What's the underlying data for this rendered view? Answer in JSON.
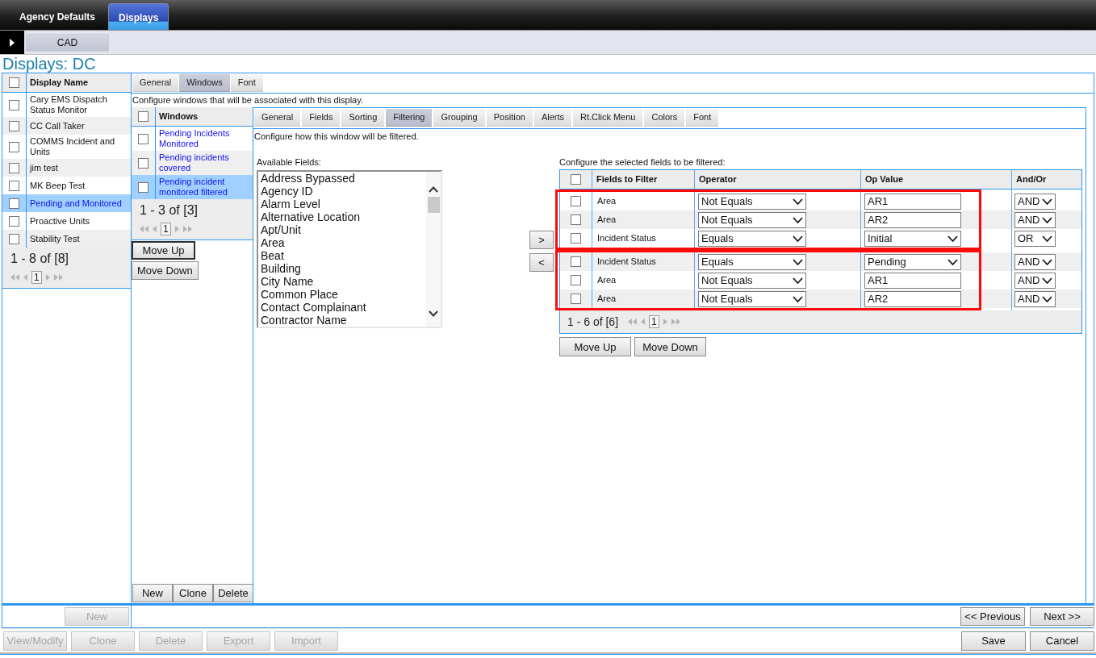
{
  "top_tabs": [
    {
      "label": "Agency Defaults",
      "selected": false
    },
    {
      "label": "Displays",
      "selected": true
    }
  ],
  "module_bar": {
    "module_button": "CAD"
  },
  "page_title": "Displays: DC",
  "displays_table": {
    "header": "Display Name",
    "header_checked": false,
    "rows": [
      {
        "name": "Cary EMS Dispatch Status Monitor",
        "checked": false,
        "selected": false
      },
      {
        "name": "CC Call Taker",
        "checked": false,
        "selected": false
      },
      {
        "name": "COMMS Incident and Units",
        "checked": false,
        "selected": false
      },
      {
        "name": "jim test",
        "checked": false,
        "selected": false
      },
      {
        "name": "MK Beep Test",
        "checked": false,
        "selected": false
      },
      {
        "name": "Pending and Monitored",
        "checked": false,
        "selected": true
      },
      {
        "name": "Proactive Units",
        "checked": false,
        "selected": false
      },
      {
        "name": "Stability Test",
        "checked": false,
        "selected": false
      }
    ],
    "pager": {
      "summary": "1 - 8 of [8]",
      "page": "1"
    }
  },
  "display_tabs": [
    {
      "label": "General",
      "selected": false
    },
    {
      "label": "Windows",
      "selected": true
    },
    {
      "label": "Font",
      "selected": false
    }
  ],
  "display_description": "Configure windows that will be associated with this display.",
  "windows_table": {
    "header": "Windows",
    "header_checked": false,
    "rows": [
      {
        "name": "Pending Incidents Monitored",
        "checked": false,
        "selected": false
      },
      {
        "name": "Pending incidents covered",
        "checked": false,
        "selected": false
      },
      {
        "name": "Pending incident monitored filtered",
        "checked": false,
        "selected": true
      }
    ],
    "pager": {
      "summary": "1 - 3 of [3]",
      "page": "1"
    }
  },
  "windows_order_buttons": [
    {
      "label": "Move Up",
      "focused": true
    },
    {
      "label": "Move Down",
      "focused": false
    }
  ],
  "windows_actions": [
    "New",
    "Clone",
    "Delete"
  ],
  "window_tabs": [
    {
      "label": "General",
      "selected": false
    },
    {
      "label": "Fields",
      "selected": false
    },
    {
      "label": "Sorting",
      "selected": false
    },
    {
      "label": "Filtering",
      "selected": true
    },
    {
      "label": "Grouping",
      "selected": false
    },
    {
      "label": "Position",
      "selected": false
    },
    {
      "label": "Alerts",
      "selected": false
    },
    {
      "label": "Rt.Click Menu",
      "selected": false
    },
    {
      "label": "Colors",
      "selected": false
    },
    {
      "label": "Font",
      "selected": false
    }
  ],
  "window_description": "Configure how this window will be filtered.",
  "available_fields": {
    "label": "Available Fields:",
    "items": [
      "Address Bypassed",
      "Agency ID",
      "Alarm Level",
      "Alternative Location",
      "Apt/Unit",
      "Area",
      "Beat",
      "Building",
      "City Name",
      "Common Place",
      "Contact Complainant",
      "Contractor Name"
    ]
  },
  "transfer_buttons": [
    ">",
    "<"
  ],
  "filter_table": {
    "caption": "Configure the selected fields to be filtered:",
    "header_checked": false,
    "columns": [
      "Fields to Filter",
      "Operator",
      "Op Value",
      "And/Or"
    ],
    "row_groups": [
      {
        "highlighted": true,
        "rows": [
          {
            "checked": false,
            "field": "Area",
            "operator": "Not Equals",
            "value": {
              "kind": "text",
              "text": "AR1"
            },
            "conjunction": "AND"
          },
          {
            "checked": false,
            "field": "Area",
            "operator": "Not Equals",
            "value": {
              "kind": "text",
              "text": "AR2"
            },
            "conjunction": "AND"
          },
          {
            "checked": false,
            "field": "Incident Status",
            "operator": "Equals",
            "value": {
              "kind": "select",
              "text": "Initial"
            },
            "conjunction": "OR"
          }
        ]
      },
      {
        "highlighted": true,
        "rows": [
          {
            "checked": false,
            "field": "Incident Status",
            "operator": "Equals",
            "value": {
              "kind": "select",
              "text": "Pending"
            },
            "conjunction": "AND"
          },
          {
            "checked": false,
            "field": "Area",
            "operator": "Not Equals",
            "value": {
              "kind": "text",
              "text": "AR1"
            },
            "conjunction": "AND"
          },
          {
            "checked": false,
            "field": "Area",
            "operator": "Not Equals",
            "value": {
              "kind": "text",
              "text": "AR2"
            },
            "conjunction": "AND"
          }
        ]
      }
    ],
    "pager": {
      "summary": "1 - 6 of [6]",
      "page": "1"
    }
  },
  "filter_order_buttons": [
    "Move Up",
    "Move Down"
  ],
  "left_footer_button": {
    "label": "New",
    "disabled": true
  },
  "nav_buttons": [
    {
      "label": "<< Previous",
      "disabled": false
    },
    {
      "label": "Next >>",
      "disabled": false
    }
  ],
  "record_actions": [
    {
      "label": "View/Modify",
      "disabled": true
    },
    {
      "label": "Clone",
      "disabled": true
    },
    {
      "label": "Delete",
      "disabled": true
    },
    {
      "label": "Export",
      "disabled": true
    },
    {
      "label": "Import",
      "disabled": true
    }
  ],
  "form_actions": [
    {
      "label": "Save",
      "disabled": false
    },
    {
      "label": "Cancel",
      "disabled": false
    }
  ]
}
